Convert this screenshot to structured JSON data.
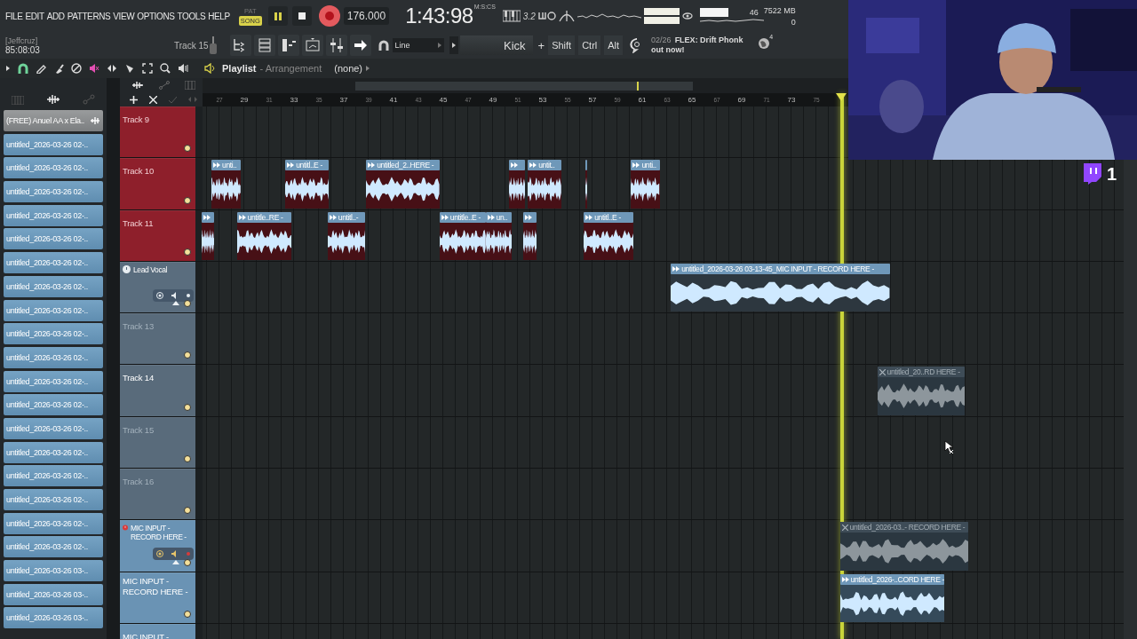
{
  "menu": [
    "FILE",
    "EDIT",
    "ADD",
    "PATTERNS",
    "VIEW",
    "OPTIONS",
    "TOOLS",
    "HELP"
  ],
  "transport": {
    "modes": [
      {
        "label": "PAT",
        "selected": false
      },
      {
        "label": "SONG",
        "selected": true
      }
    ],
    "playing": true,
    "recording": true,
    "tempo": "176.000",
    "time": "1:43:98",
    "time_unit": "M:S:CS",
    "countdown": "3.2"
  },
  "monitor": {
    "cpu": "46",
    "memory": "7522 MB",
    "polyphony": "0"
  },
  "hint": {
    "user": "[Jeffcruz]",
    "value": "85:08:03"
  },
  "current_track": "Track 15",
  "snap": "Line",
  "pattern": "Kick",
  "pattern_add": "+",
  "modifiers": [
    "Shift",
    "Ctrl",
    "Alt"
  ],
  "news": {
    "date": "02/26",
    "text": "FLEX: Drift Phonk out now!"
  },
  "globe_badge": "4",
  "playlist": {
    "title": "Playlist",
    "subtitle": "- Arrangement",
    "pattern": "(none)"
  },
  "browser": {
    "items": [
      {
        "label": "(FREE) Anuel AA x Ela..",
        "selected": true
      },
      {
        "label": "untitled_2026-03-26 02-..",
        "selected": false
      },
      {
        "label": "untitled_2026-03-26 02-..",
        "selected": false
      },
      {
        "label": "untitled_2026-03-26 02-..",
        "selected": false
      },
      {
        "label": "untitled_2026-03-26 02-..",
        "selected": false
      },
      {
        "label": "untitled_2026-03-26 02-..",
        "selected": false
      },
      {
        "label": "untitled_2026-03-26 02-..",
        "selected": false
      },
      {
        "label": "untitled_2026-03-26 02-..",
        "selected": false
      },
      {
        "label": "untitled_2026-03-26 02-..",
        "selected": false
      },
      {
        "label": "untitled_2026-03-26 02-..",
        "selected": false
      },
      {
        "label": "untitled_2026-03-26 02-..",
        "selected": false
      },
      {
        "label": "untitled_2026-03-26 02-..",
        "selected": false
      },
      {
        "label": "untitled_2026-03-26 02-..",
        "selected": false
      },
      {
        "label": "untitled_2026-03-26 02-..",
        "selected": false
      },
      {
        "label": "untitled_2026-03-26 02-..",
        "selected": false
      },
      {
        "label": "untitled_2026-03-26 02-..",
        "selected": false
      },
      {
        "label": "untitled_2026-03-26 02-..",
        "selected": false
      },
      {
        "label": "untitled_2026-03-26 02-..",
        "selected": false
      },
      {
        "label": "untitled_2026-03-26 02-..",
        "selected": false
      },
      {
        "label": "untitled_2026-03-26 03-..",
        "selected": false
      },
      {
        "label": "untitled_2026-03-26 03-..",
        "selected": false
      },
      {
        "label": "untitled_2026-03-26 03-..",
        "selected": false
      }
    ]
  },
  "ruler": [
    {
      "label": "27",
      "major": false
    },
    {
      "label": "29",
      "major": true
    },
    {
      "label": "31",
      "major": false
    },
    {
      "label": "33",
      "major": true
    },
    {
      "label": "35",
      "major": false
    },
    {
      "label": "37",
      "major": true
    },
    {
      "label": "39",
      "major": false
    },
    {
      "label": "41",
      "major": true
    },
    {
      "label": "43",
      "major": false
    },
    {
      "label": "45",
      "major": true
    },
    {
      "label": "47",
      "major": false
    },
    {
      "label": "49",
      "major": true
    },
    {
      "label": "51",
      "major": false
    },
    {
      "label": "53",
      "major": true
    },
    {
      "label": "55",
      "major": false
    },
    {
      "label": "57",
      "major": true
    },
    {
      "label": "59",
      "major": false
    },
    {
      "label": "61",
      "major": true
    },
    {
      "label": "63",
      "major": false
    },
    {
      "label": "65",
      "major": true
    },
    {
      "label": "67",
      "major": false
    },
    {
      "label": "69",
      "major": true
    },
    {
      "label": "71",
      "major": false
    },
    {
      "label": "73",
      "major": true
    },
    {
      "label": "75",
      "major": false
    }
  ],
  "tracks": [
    {
      "name": "Track 9",
      "color": "#8e1f2b",
      "dim": false,
      "kind": "plain"
    },
    {
      "name": "Track 10",
      "color": "#8e1f2b",
      "dim": false,
      "kind": "plain",
      "clips": [
        {
          "label": "unti..",
          "muted": false
        },
        {
          "label": "untitl..E -",
          "muted": false
        },
        {
          "label": "untitled_2..HERE -",
          "muted": false
        },
        {
          "muted": false
        },
        {
          "label": "untit..",
          "muted": false
        },
        {
          "muted": false
        },
        {
          "label": "unti..",
          "muted": false
        }
      ]
    },
    {
      "name": "Track 11",
      "color": "#8e1f2b",
      "dim": false,
      "kind": "plain",
      "clips": [
        {
          "muted": false
        },
        {
          "label": "untitle..RE -",
          "muted": false
        },
        {
          "label": "untitl..-",
          "muted": false
        },
        {
          "label": "untitle..E -",
          "muted": false
        },
        {
          "label": "un..",
          "muted": false
        },
        {
          "muted": false
        },
        {
          "label": "untitl..E -",
          "muted": false
        }
      ]
    },
    {
      "name": "Lead Vocal",
      "color": "#5a6d7e",
      "dim": false,
      "kind": "expanded",
      "armed": false,
      "clips": [
        {
          "label": "untitled_2026-03-26 03-13-45_MIC INPUT - RECORD HERE -",
          "muted": false
        }
      ]
    },
    {
      "name": "Track 13",
      "color": "#596b7b",
      "dim": true,
      "kind": "plain"
    },
    {
      "name": "Track 14",
      "color": "#596b7b",
      "dim": false,
      "kind": "plain",
      "clips": [
        {
          "label": "untitled_20..RD HERE -",
          "muted": true
        }
      ]
    },
    {
      "name": "Track 15",
      "color": "#596b7b",
      "dim": true,
      "kind": "plain"
    },
    {
      "name": "Track 16",
      "color": "#596b7b",
      "dim": true,
      "kind": "plain"
    },
    {
      "name": "MIC INPUT - RECORD HERE -",
      "color": "#6a93b4",
      "dim": false,
      "kind": "expanded",
      "armed": true,
      "clips": [
        {
          "label": "untitled_2026-03..- RECORD HERE -",
          "muted": true
        }
      ]
    },
    {
      "name": "MIC INPUT - RECORD HERE -",
      "color": "#6a93b4",
      "dim": false,
      "kind": "plain",
      "clips": [
        {
          "label": "untitled_2026-..CORD HERE -",
          "muted": false
        }
      ]
    },
    {
      "name": "MIC INPUT -",
      "color": "#6a93b4",
      "dim": false,
      "kind": "plain"
    }
  ],
  "stream_badge": {
    "count": "1"
  }
}
